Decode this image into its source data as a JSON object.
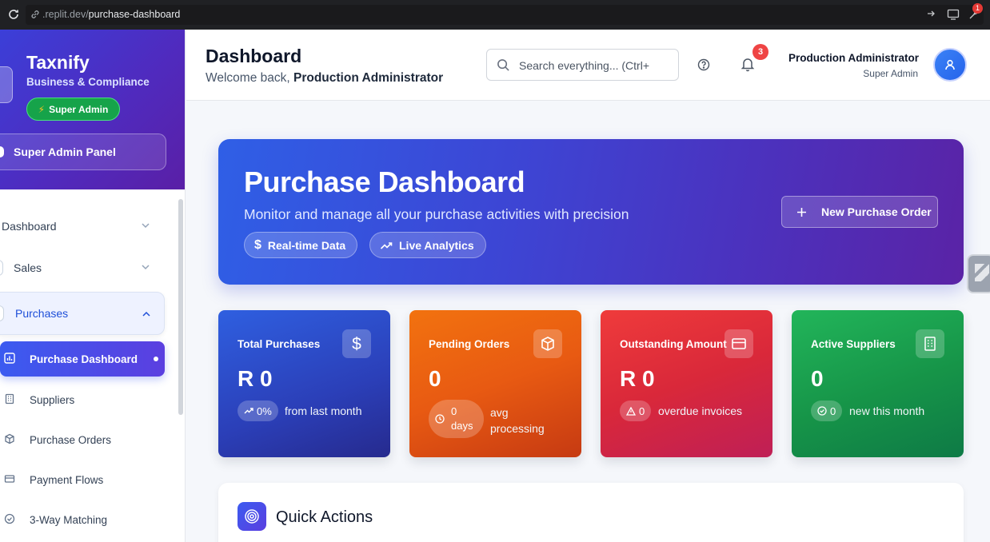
{
  "browser": {
    "url_prefix": ".replit.dev/",
    "url_path": "purchase-dashboard",
    "extension_badge": "1"
  },
  "sidebar": {
    "brand": "Taxnify",
    "subtitle": "Business & Compliance",
    "role_badge": "Super Admin",
    "panel_button": "Super Admin Panel",
    "nav": [
      {
        "label": "Dashboard"
      },
      {
        "label": "Sales"
      },
      {
        "label": "Purchases"
      }
    ],
    "purchases_sub": [
      {
        "label": "Purchase Dashboard",
        "icon": "bar-chart-icon"
      },
      {
        "label": "Suppliers",
        "icon": "building-icon"
      },
      {
        "label": "Purchase Orders",
        "icon": "package-icon"
      },
      {
        "label": "Payment Flows",
        "icon": "credit-card-icon"
      },
      {
        "label": "3-Way Matching",
        "icon": "check-circle-icon"
      }
    ]
  },
  "header": {
    "title": "Dashboard",
    "welcome_prefix": "Welcome back,",
    "welcome_name": "Production Administrator",
    "search_placeholder": "Search everything... (Ctrl+",
    "notification_count": "3",
    "user_name": "Production Administrator",
    "user_role": "Super Admin"
  },
  "hero": {
    "title": "Purchase Dashboard",
    "subtitle": "Monitor and manage all your purchase activities with precision",
    "pill_realtime": "Real-time Data",
    "pill_analytics": "Live Analytics",
    "button": "New Purchase Order"
  },
  "stats": [
    {
      "title": "Total Purchases",
      "value": "R 0",
      "chip": "0%",
      "note": "from last month",
      "icon": "dollar-icon"
    },
    {
      "title": "Pending Orders",
      "value": "0",
      "chip_line1": "0",
      "chip_line2": "days",
      "note_line1": "avg",
      "note_line2": "processing",
      "icon": "package-icon"
    },
    {
      "title": "Outstanding Amount",
      "value": "R 0",
      "chip": "0",
      "note": "overdue invoices",
      "icon": "credit-card-icon"
    },
    {
      "title": "Active Suppliers",
      "value": "0",
      "chip": "0",
      "note": "new this month",
      "icon": "building-icon"
    }
  ],
  "quick_actions": {
    "title": "Quick Actions"
  },
  "colors": {
    "accent": "#3b5bf0",
    "hero_start": "#2f5fe6",
    "hero_end": "#5a23a6",
    "card_blue": "#2f5fe0",
    "card_orange": "#f2720f",
    "card_red": "#ef3b3b",
    "card_green": "#22b55a"
  }
}
